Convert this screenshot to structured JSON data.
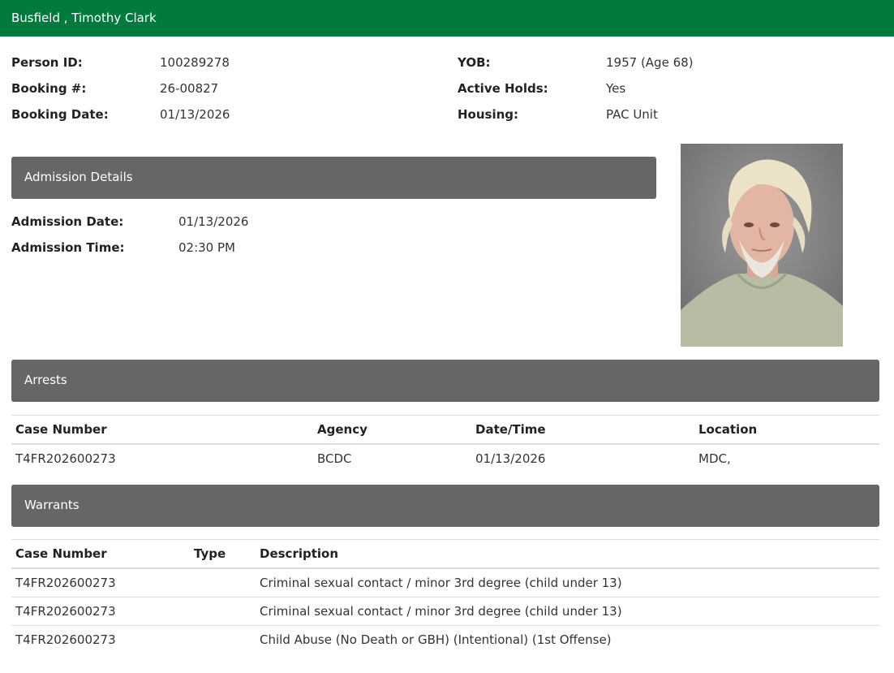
{
  "header": {
    "name": "Busfield , Timothy Clark"
  },
  "summary": {
    "person_id_label": "Person ID:",
    "person_id": "100289278",
    "booking_label": "Booking #:",
    "booking": "26-00827",
    "booking_date_label": "Booking Date:",
    "booking_date": "01/13/2026",
    "yob_label": "YOB:",
    "yob": "1957 (Age 68)",
    "holds_label": "Active Holds:",
    "holds": "Yes",
    "housing_label": "Housing:",
    "housing": "PAC Unit"
  },
  "admission": {
    "title": "Admission Details",
    "date_label": "Admission Date:",
    "date": "01/13/2026",
    "time_label": "Admission Time:",
    "time": "02:30 PM"
  },
  "arrests": {
    "title": "Arrests",
    "headers": [
      "Case Number",
      "Agency",
      "Date/Time",
      "Location"
    ],
    "rows": [
      [
        "T4FR202600273",
        "BCDC",
        "01/13/2026",
        "MDC,"
      ]
    ]
  },
  "warrants": {
    "title": "Warrants",
    "headers": [
      "Case Number",
      "Type",
      "Description"
    ],
    "rows": [
      [
        "T4FR202600273",
        "",
        "Criminal sexual contact / minor 3rd degree (child under 13)"
      ],
      [
        "T4FR202600273",
        "",
        "Criminal sexual contact / minor 3rd degree (child under 13)"
      ],
      [
        "T4FR202600273",
        "",
        "Child Abuse (No Death or GBH) (Intentional) (1st Offense)"
      ]
    ]
  }
}
